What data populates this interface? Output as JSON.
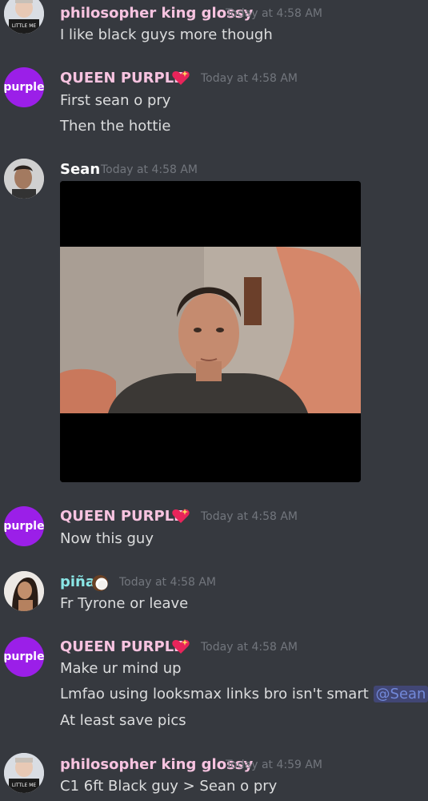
{
  "messages": [
    {
      "author": "philosopher king glossy",
      "timestamp": "Today at 4:58 AM",
      "lines": [
        "I like black guys more though"
      ]
    },
    {
      "author": "QUEEN PURPLE",
      "avatar_text": "purple",
      "timestamp": "Today at 4:58 AM",
      "lines": [
        "First sean o pry",
        "Then the hottie"
      ]
    },
    {
      "author": "Sean",
      "timestamp": "Today at 4:58 AM",
      "attachment": "selfie-photo"
    },
    {
      "author": "QUEEN PURPLE",
      "avatar_text": "purple",
      "timestamp": "Today at 4:58 AM",
      "lines": [
        "Now this guy"
      ]
    },
    {
      "author": "piña",
      "timestamp": "Today at 4:58 AM",
      "lines": [
        "Fr Tyrone or leave"
      ]
    },
    {
      "author": "QUEEN PURPLE",
      "avatar_text": "purple",
      "timestamp": "Today at 4:58 AM",
      "lines": [
        "Make ur mind up",
        "Lmfao using looksmax links bro  isn't smart",
        "At least save pics"
      ],
      "mention": "@Sean"
    },
    {
      "author": "philosopher king glossy",
      "timestamp": "Today at 4:59 AM",
      "lines": [
        "C1 6ft Black guy > Sean o pry"
      ]
    }
  ],
  "colors": {
    "background": "#36393f",
    "queen_purple_name": "#f7c3e0",
    "pina_name": "#8ae6e6",
    "timestamp": "#72767d",
    "text": "#dcddde",
    "mention": "#7289da",
    "purple_avatar": "#9b1fe8"
  },
  "icons": [
    "sparkling-heart-emoji",
    "coconut-emoji"
  ]
}
